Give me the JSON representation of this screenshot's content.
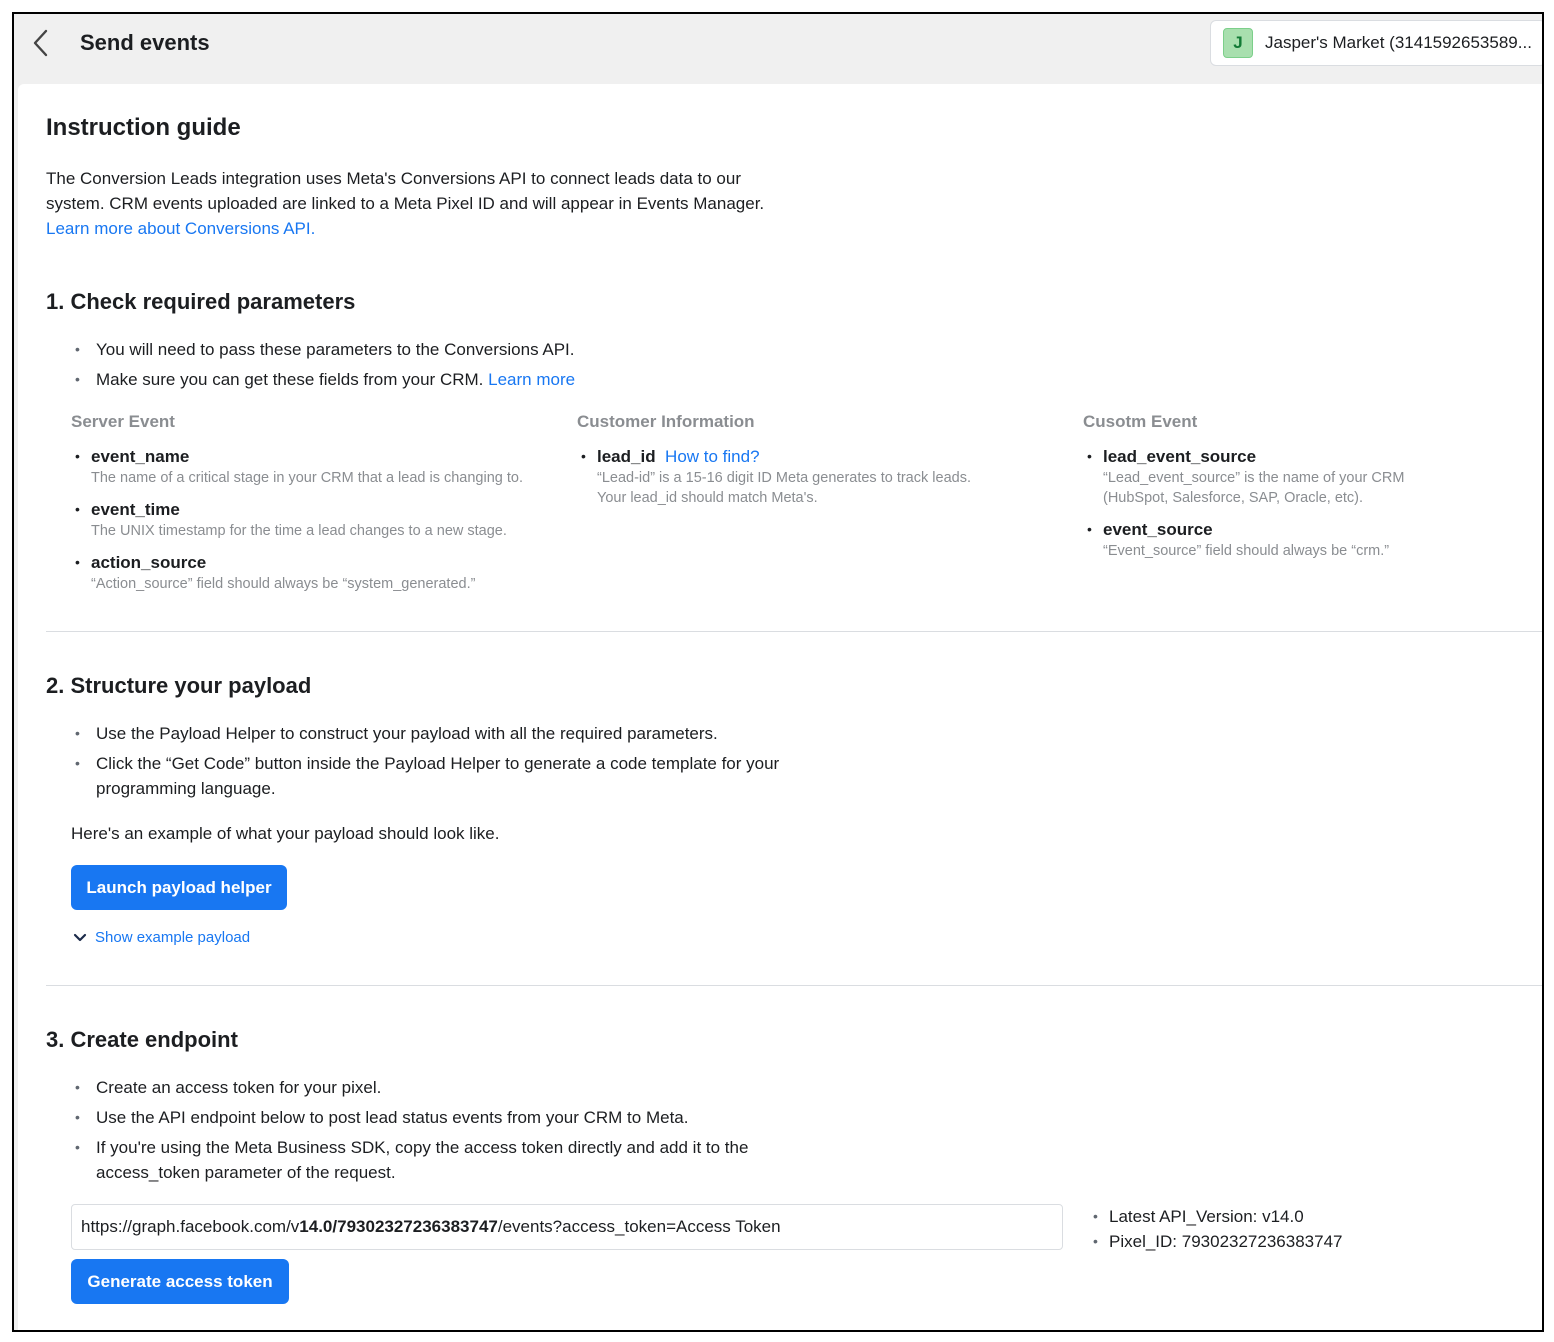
{
  "header": {
    "title": "Send events",
    "account": {
      "initial": "J",
      "name": "Jasper's Market (3141592653589..."
    }
  },
  "guide": {
    "title": "Instruction guide",
    "intro": "The Conversion Leads integration uses Meta's Conversions API to connect leads data to our system. CRM events uploaded are linked to a Meta Pixel ID and will appear in Events Manager.",
    "intro_link": "Learn more about Conversions API."
  },
  "step1": {
    "title": "1. Check required parameters",
    "bullet1": "You will need to pass these parameters to the Conversions API.",
    "bullet2": "Make sure you can get these fields from your CRM.",
    "bullet2_link": "Learn more",
    "columns": {
      "server": {
        "heading": "Server Event",
        "params": [
          {
            "name": "event_name",
            "desc": "The name of a critical stage in your CRM that a lead is changing to."
          },
          {
            "name": "event_time",
            "desc": "The UNIX timestamp for the time a lead changes to a new stage."
          },
          {
            "name": "action_source",
            "desc": "“Action_source” field should always be “system_generated.”"
          }
        ]
      },
      "customer": {
        "heading": "Customer Information",
        "params": [
          {
            "name": "lead_id",
            "link": "How to find?",
            "desc1": "“Lead-id” is a 15-16 digit ID Meta generates to track leads.",
            "desc2": "Your lead_id should match Meta's."
          }
        ]
      },
      "custom": {
        "heading": "Cusotm Event",
        "params": [
          {
            "name": "lead_event_source",
            "desc1": "“Lead_event_source” is the name of your CRM",
            "desc2": "(HubSpot, Salesforce, SAP, Oracle, etc)."
          },
          {
            "name": "event_source",
            "desc": "“Event_source” field should always be “crm.”"
          }
        ]
      }
    }
  },
  "step2": {
    "title": "2. Structure your payload",
    "bullet1": "Use the Payload Helper to construct your payload with all the required parameters.",
    "bullet2_line1": "Click the “Get Code” button inside the Payload Helper to generate a code template for your",
    "bullet2_line2": "programming language.",
    "example_text": "Here's an example of what your payload should look like.",
    "launch_button": "Launch payload helper",
    "show_example": "Show example payload"
  },
  "step3": {
    "title": "3. Create endpoint",
    "bullet1": "Create an access token for your pixel.",
    "bullet2": "Use the API endpoint below to post lead status events from your CRM to Meta.",
    "bullet3_line1": "If you're using the Meta Business SDK, copy the access token directly and add it to the",
    "bullet3_line2": "access_token parameter of the request.",
    "endpoint": {
      "prefix": "https://graph.facebook.com/v",
      "version": "14.0",
      "sep": "/",
      "pixel": "79302327236383747",
      "suffix": "/events?access_token=Access Token"
    },
    "api_version": "Latest API_Version: v14.0",
    "pixel_id": "Pixel_ID: 79302327236383747",
    "generate_button": "Generate access token"
  },
  "colors": {
    "accent": "#1877f2",
    "muted": "#8a8d91",
    "divider": "#dadde1"
  }
}
